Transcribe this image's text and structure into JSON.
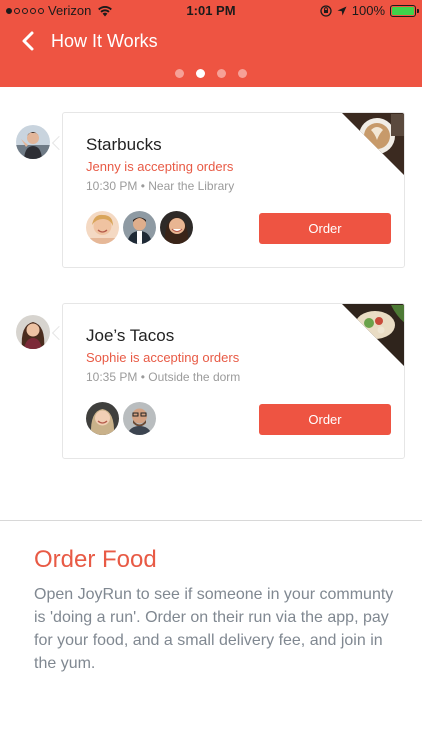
{
  "status_bar": {
    "carrier": "Verizon",
    "time": "1:01 PM",
    "battery": "100%",
    "battery_level": 1.0,
    "signal_bars": 1
  },
  "nav": {
    "title": "How It Works",
    "back_icon": "chevron-left-icon"
  },
  "pager": {
    "count": 4,
    "active_index": 1
  },
  "runs": [
    {
      "title": "Starbucks",
      "status": "Jenny is accepting orders",
      "meta": "10:30 PM • Near the Library",
      "order_label": "Order",
      "participants": 3
    },
    {
      "title": "Joe’s Tacos",
      "status": "Sophie is accepting orders",
      "meta": "10:35 PM • Outside the dorm",
      "order_label": "Order",
      "participants": 2
    }
  ],
  "section": {
    "title": "Order Food",
    "body": "Open JoyRun to see if someone in your communty is 'doing a run'. Order on their run via the app, pay for your food, and a small delivery fee, and join in the yum."
  },
  "colors": {
    "accent": "#ee5442",
    "status_text": "#e85a45",
    "meta_text": "#9b9b9b",
    "body_text": "#808891"
  }
}
